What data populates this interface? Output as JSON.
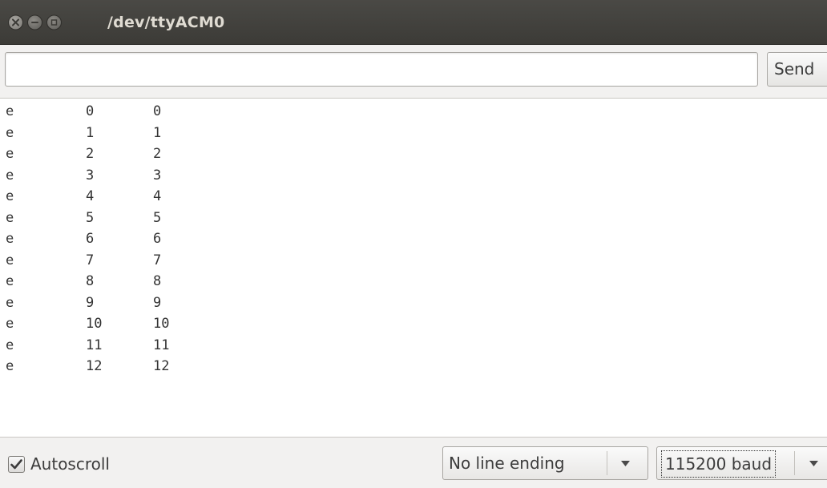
{
  "window": {
    "title": "/dev/ttyACM0"
  },
  "input": {
    "value": "",
    "send_label": "Send"
  },
  "output": {
    "lines": [
      [
        "e",
        "0",
        "0"
      ],
      [
        "e",
        "1",
        "1"
      ],
      [
        "e",
        "2",
        "2"
      ],
      [
        "e",
        "3",
        "3"
      ],
      [
        "e",
        "4",
        "4"
      ],
      [
        "e",
        "5",
        "5"
      ],
      [
        "e",
        "6",
        "6"
      ],
      [
        "e",
        "7",
        "7"
      ],
      [
        "e",
        "8",
        "8"
      ],
      [
        "e",
        "9",
        "9"
      ],
      [
        "e",
        "10",
        "10"
      ],
      [
        "e",
        "11",
        "11"
      ],
      [
        "e",
        "12",
        "12"
      ]
    ]
  },
  "footer": {
    "autoscroll_label": "Autoscroll",
    "autoscroll_checked": true,
    "line_ending": "No line ending",
    "baud_rate": "115200 baud"
  },
  "icons": {
    "close": "close-icon",
    "minimize": "minimize-icon",
    "maximize": "maximize-icon",
    "checkbox": "check-icon",
    "dropdown": "chevron-down-icon"
  },
  "colors": {
    "titlebar": "#3c3b37",
    "title_text": "#dfdbd2",
    "window_bg": "#f2f1f0",
    "output_bg": "#ffffff"
  }
}
